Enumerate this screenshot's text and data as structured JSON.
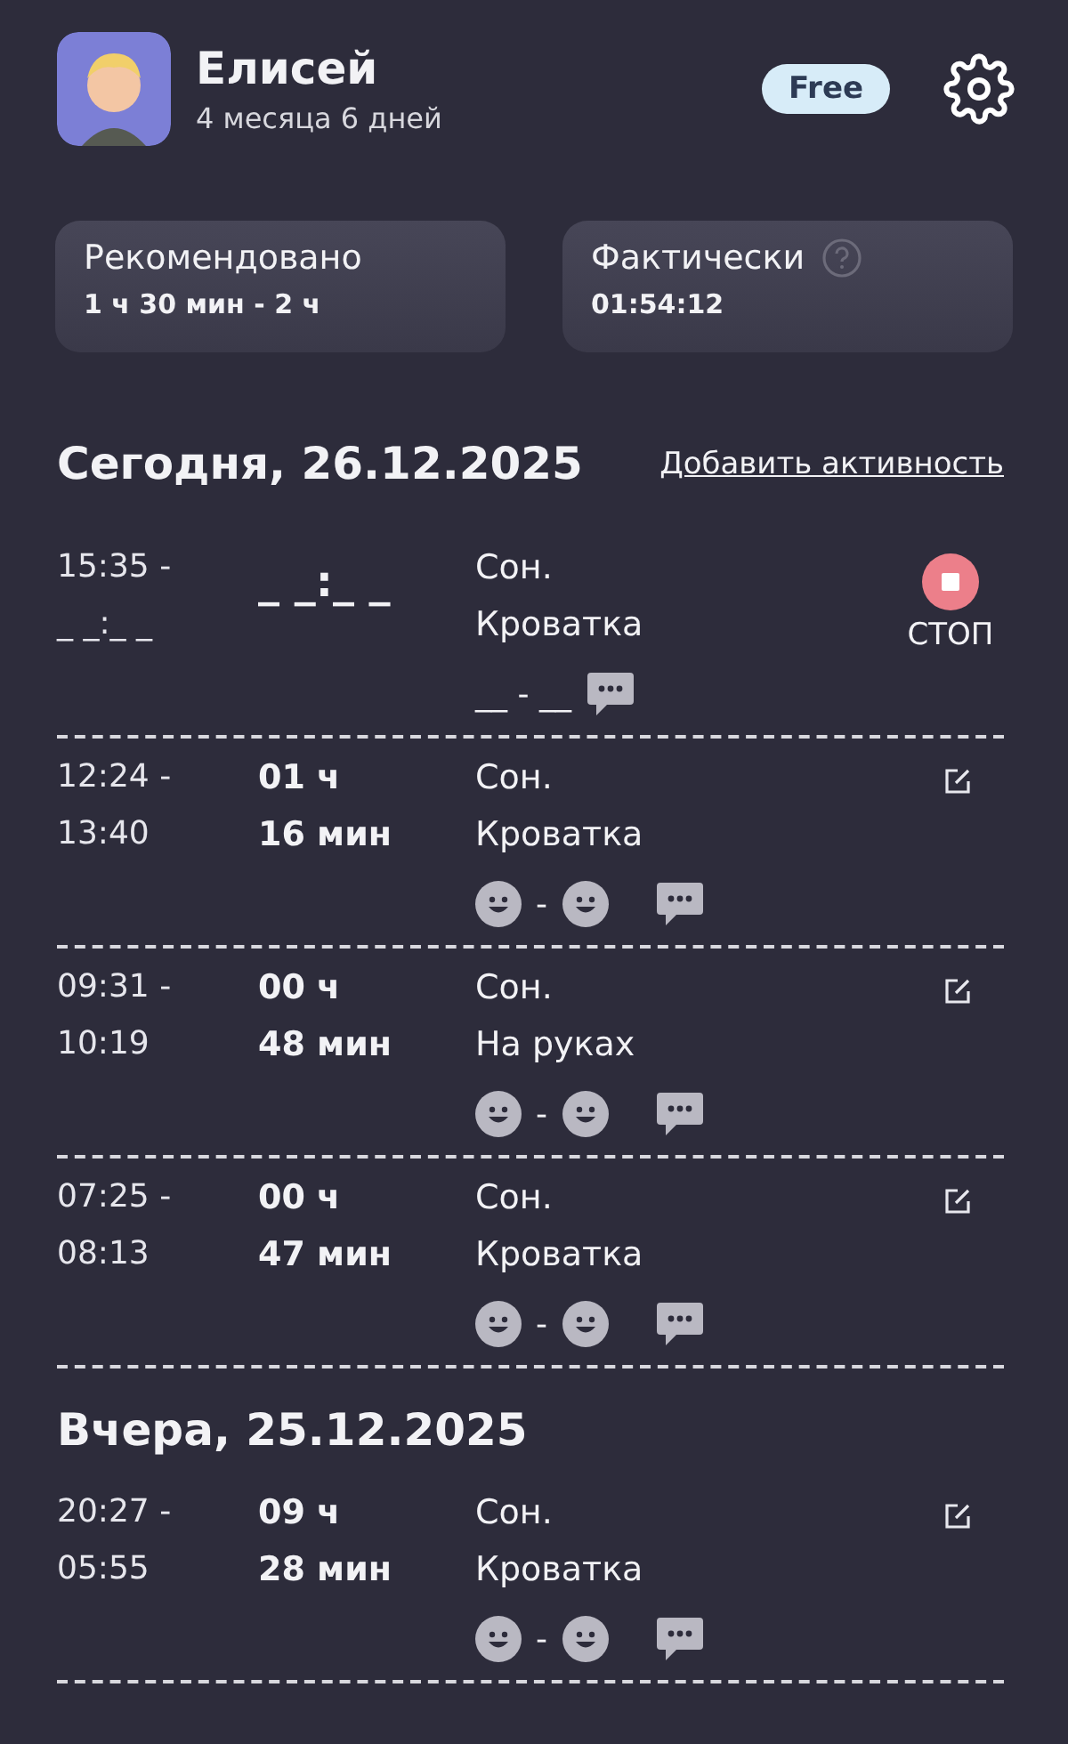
{
  "profile": {
    "name": "Елисей",
    "age": "4 месяца 6 дней",
    "plan": "Free"
  },
  "summary": [
    {
      "label": "Рекомендовано",
      "value": "1 ч 30 мин - 2 ч",
      "help": false
    },
    {
      "label": "Фактически",
      "value": "01:54:12",
      "help": true
    }
  ],
  "sections": [
    {
      "title": "Сегодня, 26.12.2025",
      "action": "Добавить активность",
      "entries": [
        {
          "kind": "active",
          "start": "15:35 -",
          "end": "_ _:_ _",
          "duration": "_ _:_ _",
          "activity": "Сон.",
          "place": "Кроватка",
          "mood": "__ - __",
          "stop": "СТОП"
        },
        {
          "kind": "done",
          "start": "12:24 -",
          "end": "13:40",
          "hours": "01 ч",
          "minutes": "16 мин",
          "activity": "Сон.",
          "place": "Кроватка",
          "mood_separator": "-"
        },
        {
          "kind": "done",
          "start": "09:31 -",
          "end": "10:19",
          "hours": "00 ч",
          "minutes": "48 мин",
          "activity": "Сон.",
          "place": "На руках",
          "mood_separator": "-"
        },
        {
          "kind": "done",
          "start": "07:25 -",
          "end": "08:13",
          "hours": "00 ч",
          "minutes": "47 мин",
          "activity": "Сон.",
          "place": "Кроватка",
          "mood_separator": "-"
        }
      ]
    },
    {
      "title": "Вчера, 25.12.2025",
      "entries": [
        {
          "kind": "done",
          "start": "20:27 -",
          "end": "05:55",
          "hours": "09 ч",
          "minutes": "28 мин",
          "activity": "Сон.",
          "place": "Кроватка",
          "mood_separator": "-"
        }
      ]
    }
  ]
}
